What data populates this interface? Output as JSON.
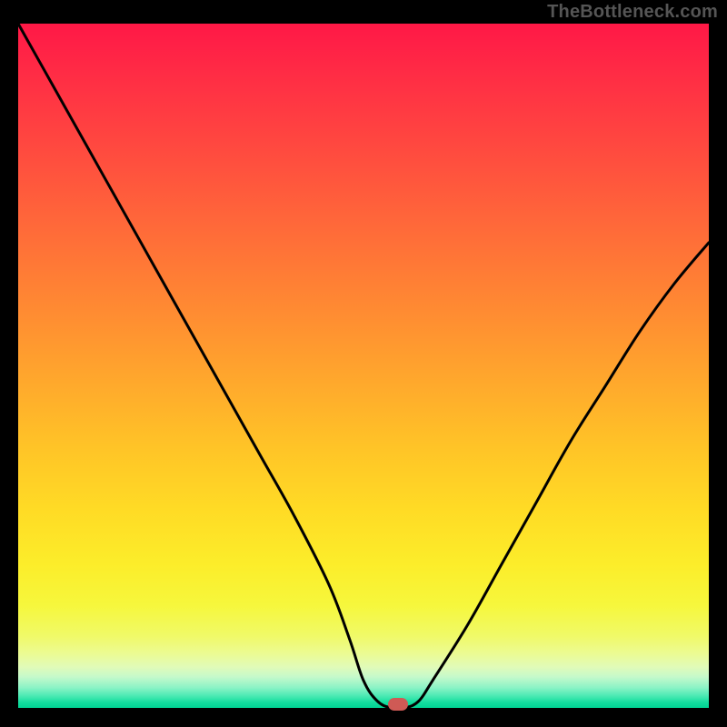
{
  "watermark": "TheBottleneck.com",
  "chart_data": {
    "type": "line",
    "title": "",
    "xlabel": "",
    "ylabel": "",
    "xlim": [
      0,
      100
    ],
    "ylim": [
      0,
      100
    ],
    "grid": false,
    "legend": false,
    "series": [
      {
        "name": "bottleneck-curve",
        "x": [
          0,
          5,
          10,
          15,
          20,
          25,
          30,
          35,
          40,
          45,
          48,
          50,
          52,
          54,
          56,
          58,
          60,
          65,
          70,
          75,
          80,
          85,
          90,
          95,
          100
        ],
        "y": [
          100,
          91,
          82,
          73,
          64,
          55,
          46,
          37,
          28,
          18,
          10,
          4,
          1,
          0,
          0,
          1,
          4,
          12,
          21,
          30,
          39,
          47,
          55,
          62,
          68
        ]
      }
    ],
    "marker": {
      "x": 55,
      "y": 0,
      "color": "#cf5a55"
    },
    "background_gradient": {
      "stops": [
        {
          "pos": 0,
          "color": "#ff1846"
        },
        {
          "pos": 0.3,
          "color": "#ff6a39"
        },
        {
          "pos": 0.62,
          "color": "#ffc427"
        },
        {
          "pos": 0.85,
          "color": "#f6f73c"
        },
        {
          "pos": 0.97,
          "color": "#8df3c6"
        },
        {
          "pos": 1.0,
          "color": "#00d493"
        }
      ]
    }
  }
}
